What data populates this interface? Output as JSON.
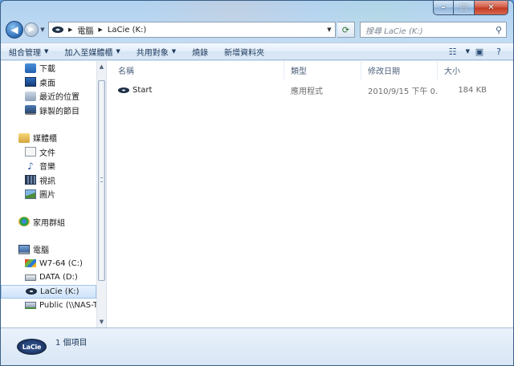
{
  "window": {
    "caption_buttons": {
      "minimize": "–",
      "maximize": "□",
      "close": "✕"
    }
  },
  "address": {
    "back_glyph": "◀",
    "forward_glyph": "▶",
    "path": [
      "電腦",
      "LaCie (K:)"
    ],
    "search_placeholder": "搜尋 LaCie (K:)"
  },
  "toolbar": {
    "organize": "組合管理",
    "add_to_library": "加入至媒體櫃",
    "share_with": "共用對象",
    "burn": "燒錄",
    "new_folder": "新增資料夾"
  },
  "sidebar": {
    "favorites": [
      {
        "label": "下載",
        "icon": "download-folder-icon"
      },
      {
        "label": "桌面",
        "icon": "desktop-icon"
      },
      {
        "label": "最近的位置",
        "icon": "recent-places-icon"
      },
      {
        "label": "錄製的節目",
        "icon": "recorded-tv-icon"
      }
    ],
    "libraries_label": "媒體櫃",
    "libraries": [
      {
        "label": "文件",
        "icon": "documents-icon"
      },
      {
        "label": "音樂",
        "icon": "music-icon"
      },
      {
        "label": "視訊",
        "icon": "videos-icon"
      },
      {
        "label": "圖片",
        "icon": "pictures-icon"
      }
    ],
    "homegroup_label": "家用群組",
    "computer_label": "電腦",
    "drives": [
      {
        "label": "W7-64 (C:)",
        "icon": "windows-drive-icon"
      },
      {
        "label": "DATA (D:)",
        "icon": "hard-drive-icon"
      },
      {
        "label": "LaCie (K:)",
        "icon": "lacie-drive-icon",
        "selected": true
      },
      {
        "label": "Public (\\\\NAS-T",
        "icon": "network-drive-icon"
      }
    ]
  },
  "columns": {
    "name": "名稱",
    "type": "類型",
    "date": "修改日期",
    "size": "大小"
  },
  "files": [
    {
      "name": "Start",
      "type": "應用程式",
      "date": "2010/9/15 下午 0...",
      "size": "184 KB",
      "icon": "lacie-app-icon"
    }
  ],
  "details": {
    "logo_text": "LaCie",
    "item_count": "1 個項目"
  }
}
